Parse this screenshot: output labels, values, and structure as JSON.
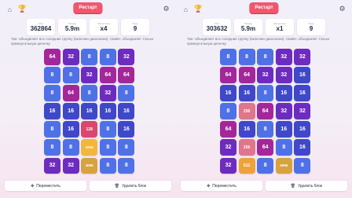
{
  "colors": {
    "8": "#4f71e8",
    "16": "#3f48c9",
    "32": "#6d2bc0",
    "64": "#a3279a",
    "128": "#d9486c",
    "256": "#e0758b",
    "512": "#f0a23a",
    "1024": "#f2b63b",
    "4096": "#d8a33c"
  },
  "icons": {
    "home": "home-icon",
    "trophy": "trophy-icon",
    "settings": "settings-icon",
    "move": "move-icon",
    "delete": "delete-icon"
  },
  "restart_label": "Рестарт",
  "hint": "Тап: объединяет все соседние группу (включая диагонали). Свайп: объединяет только прямоугольную цепочку",
  "move_label": "Переместить",
  "delete_label": "Удалить блок",
  "panels": [
    {
      "stats": [
        {
          "label": "Счет",
          "value": "362864"
        },
        {
          "label": "Рекорд",
          "value": "5.9m"
        },
        {
          "label": "Множитель",
          "value": "x4"
        },
        {
          "label": "Ходы",
          "value": "9"
        }
      ],
      "board": [
        [
          64,
          32,
          8,
          8,
          32
        ],
        [
          8,
          8,
          32,
          64,
          64
        ],
        [
          8,
          64,
          8,
          32,
          8
        ],
        [
          16,
          16,
          16,
          16,
          16
        ],
        [
          8,
          16,
          128,
          8,
          16
        ],
        [
          8,
          8,
          1024,
          8,
          8
        ],
        [
          32,
          32,
          4096,
          8,
          8
        ]
      ]
    },
    {
      "stats": [
        {
          "label": "Счет",
          "value": "303632"
        },
        {
          "label": "Рекорд",
          "value": "5.9m"
        },
        {
          "label": "Множитель",
          "value": "x1"
        },
        {
          "label": "Ходы",
          "value": "9"
        }
      ],
      "board": [
        [
          8,
          8,
          8,
          32,
          32
        ],
        [
          64,
          64,
          32,
          32,
          16
        ],
        [
          16,
          16,
          8,
          16,
          16
        ],
        [
          8,
          256,
          64,
          32,
          32
        ],
        [
          64,
          16,
          8,
          16,
          16
        ],
        [
          32,
          256,
          64,
          8,
          16
        ],
        [
          32,
          512,
          8,
          4096,
          8
        ]
      ]
    }
  ]
}
